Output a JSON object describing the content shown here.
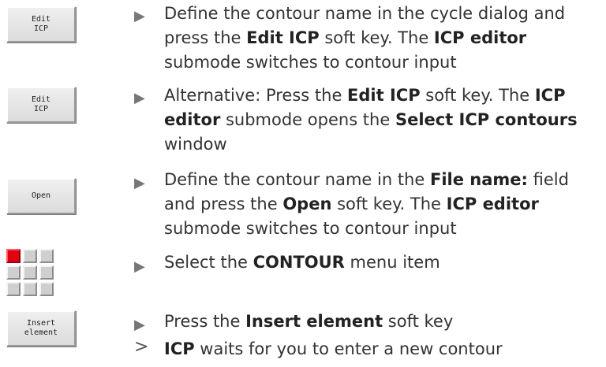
{
  "softkeys": {
    "edit_icp_1": [
      "Edit",
      "ICP"
    ],
    "edit_icp_2": [
      "Edit",
      "ICP"
    ],
    "open": [
      "Open"
    ],
    "insert_element": [
      "Insert",
      "element"
    ]
  },
  "menu_icon": {
    "name": "contour-menu-grid-icon",
    "active_color": "#e3000f"
  },
  "steps": [
    {
      "parts": [
        "Define the contour name in the cycle dialog and press the ",
        "Edit ICP",
        " soft key. The ",
        "ICP editor",
        " submode switches to contour input"
      ]
    },
    {
      "parts": [
        "Alternative: Press the ",
        "Edit ICP",
        " soft key. The ",
        "ICP editor",
        " submode opens the ",
        "Select ICP contours",
        " window"
      ]
    },
    {
      "parts": [
        "Define the contour name in the ",
        "File name:",
        " field and press the ",
        "Open",
        " soft key. The ",
        "ICP editor",
        " submode switches to contour input"
      ]
    },
    {
      "parts": [
        "Select the ",
        "CONTOUR",
        " menu item"
      ]
    },
    {
      "parts": [
        "Press the ",
        "Insert element",
        " soft key"
      ]
    }
  ],
  "result": {
    "parts": [
      "ICP",
      " waits for you to enter a new contour"
    ]
  },
  "symbols": {
    "bullet": "▶",
    "result_arrow": ">"
  }
}
